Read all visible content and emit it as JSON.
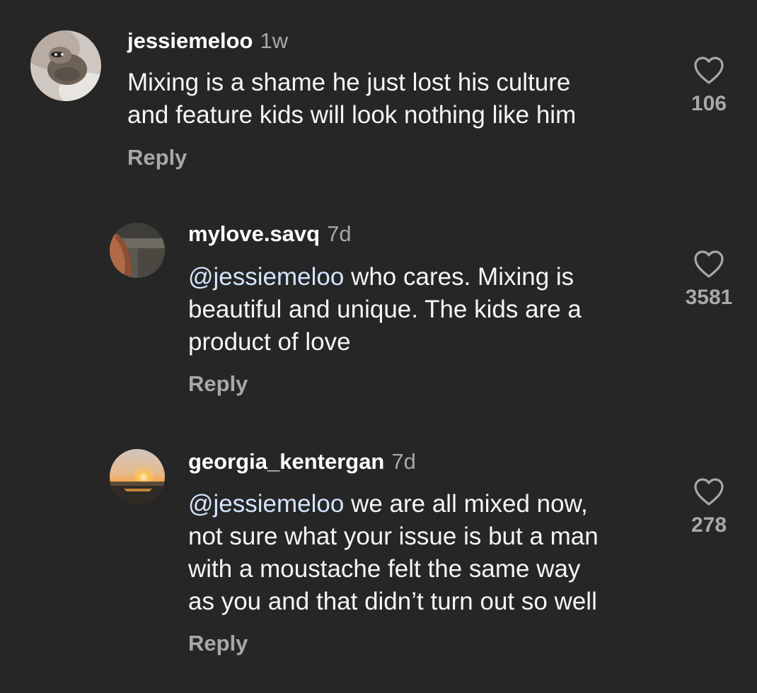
{
  "colors": {
    "background": "#262626",
    "text": "#ffffff",
    "secondary": "#a8a8a8",
    "mention": "#d3e4fd"
  },
  "comments": [
    {
      "username": "jessiemeloo",
      "time": "1w",
      "lines": [
        "Mixing is a shame he just lost his culture",
        "and feature kids will look nothing like him"
      ],
      "reply_label": "Reply",
      "likes": "106",
      "avatar_icon": "raccoon-avatar"
    },
    {
      "username": "mylove.savq",
      "time": "7d",
      "mention": "@jessiemeloo",
      "line1_rest": " who cares. Mixing is",
      "lines": [
        "beautiful and unique. The kids are a",
        "product of love"
      ],
      "reply_label": "Reply",
      "likes": "3581",
      "avatar_icon": "hair-photo-avatar"
    },
    {
      "username": "georgia_kentergan",
      "time": "7d",
      "mention": "@jessiemeloo",
      "line1_rest": " we are all mixed now,",
      "lines": [
        "not sure what your issue is but a man",
        "with a moustache felt the same way",
        "as you and that didn’t turn out so well"
      ],
      "reply_label": "Reply",
      "likes": "278",
      "avatar_icon": "sunset-avatar"
    }
  ]
}
